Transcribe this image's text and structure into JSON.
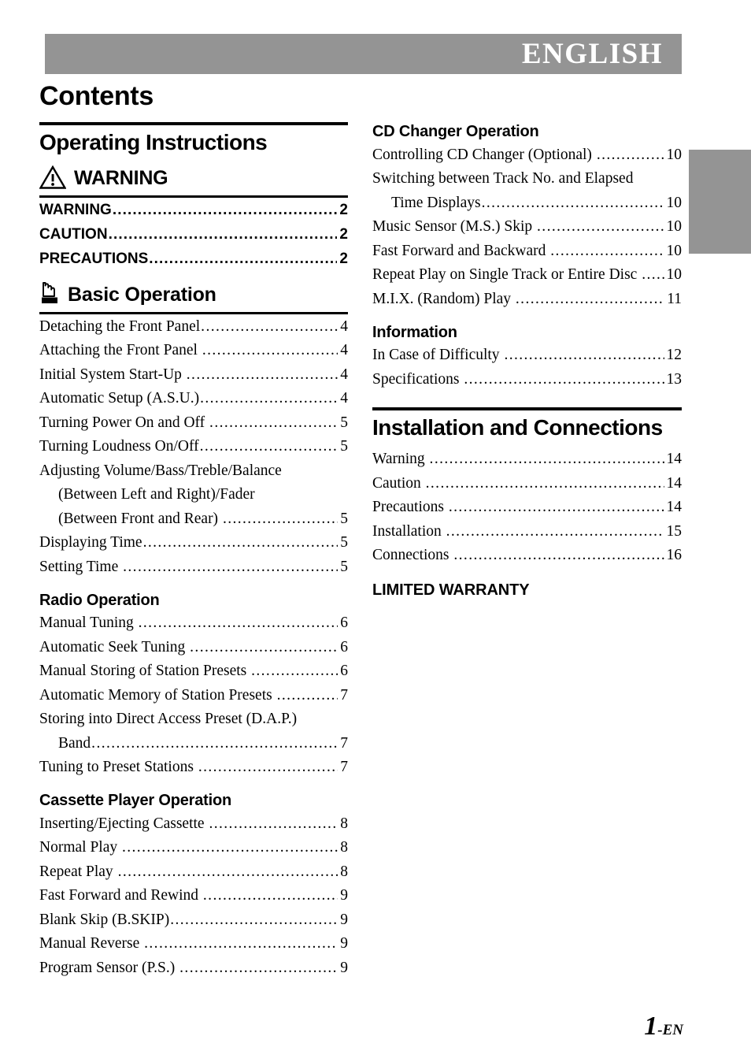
{
  "header": {
    "language_label": "ENGLISH",
    "band_color": "#949494"
  },
  "page_title": "Contents",
  "folio": {
    "number": "1",
    "suffix": "-EN"
  },
  "left_column": {
    "banner_heading": "Operating Instructions",
    "warning_section": {
      "icon": "warning-triangle-icon",
      "heading": "WARNING",
      "entries": [
        {
          "title": "WARNING",
          "page": "2"
        },
        {
          "title": "CAUTION",
          "page": "2"
        },
        {
          "title": "PRECAUTIONS",
          "page": "2"
        }
      ]
    },
    "basic_operation": {
      "icon": "hand-press-button-icon",
      "heading": "Basic Operation",
      "entries": [
        {
          "title": "Detaching the Front Panel",
          "page": "4"
        },
        {
          "title": "Attaching the Front Panel ",
          "page": "4"
        },
        {
          "title": "Initial System Start-Up ",
          "page": "4"
        },
        {
          "title": "Automatic Setup (A.S.U.)",
          "page": "4"
        },
        {
          "title": "Turning Power On and Off ",
          "page": "5"
        },
        {
          "title": "Turning Loudness On/Off",
          "page": "5"
        },
        {
          "title": "Adjusting Volume/Bass/Treble/Balance",
          "page": "",
          "leader": false
        },
        {
          "title": "(Between Left and Right)/Fader",
          "page": "",
          "leader": false,
          "indent": true
        },
        {
          "title": "(Between Front and Rear) ",
          "page": "5",
          "indent": true
        },
        {
          "title": "Displaying Time",
          "page": "5"
        },
        {
          "title": "Setting Time ",
          "page": "5"
        }
      ]
    },
    "radio_operation": {
      "heading": "Radio Operation",
      "entries": [
        {
          "title": "Manual Tuning ",
          "page": "6"
        },
        {
          "title": "Automatic Seek Tuning ",
          "page": "6"
        },
        {
          "title": "Manual Storing of Station Presets ",
          "page": "6"
        },
        {
          "title": "Automatic Memory of Station Presets ",
          "page": "7"
        },
        {
          "title": "Storing into Direct Access Preset (D.A.P.)",
          "page": "",
          "leader": false
        },
        {
          "title": "Band",
          "page": "7",
          "indent": true
        },
        {
          "title": "Tuning to Preset Stations ",
          "page": "7"
        }
      ]
    },
    "cassette_player_operation": {
      "heading": "Cassette Player Operation",
      "entries": [
        {
          "title": "Inserting/Ejecting Cassette ",
          "page": "8"
        },
        {
          "title": "Normal Play ",
          "page": "8"
        },
        {
          "title": "Repeat Play ",
          "page": "8"
        },
        {
          "title": "Fast Forward and Rewind ",
          "page": "9"
        },
        {
          "title": "Blank Skip (B.SKIP)",
          "page": "9"
        },
        {
          "title": "Manual Reverse ",
          "page": "9"
        },
        {
          "title": "Program Sensor (P.S.) ",
          "page": "9"
        }
      ]
    }
  },
  "right_column": {
    "cd_changer_operation": {
      "heading": "CD Changer Operation",
      "entries": [
        {
          "title": "Controlling CD Changer (Optional) ",
          "page": "10"
        },
        {
          "title": "Switching between Track No. and Elapsed",
          "page": "",
          "leader": false
        },
        {
          "title": "Time Displays",
          "page": "10",
          "indent": true
        },
        {
          "title": "Music Sensor (M.S.) Skip ",
          "page": "10"
        },
        {
          "title": "Fast Forward and Backward ",
          "page": "10"
        },
        {
          "title": "Repeat Play on Single Track or Entire Disc ",
          "page": "10"
        },
        {
          "title": "M.I.X. (Random) Play ",
          "page": "11"
        }
      ]
    },
    "information": {
      "heading": "Information",
      "entries": [
        {
          "title": "In Case of Difficulty ",
          "page": "12"
        },
        {
          "title": "Specifications ",
          "page": "13"
        }
      ]
    },
    "installation_and_connections": {
      "banner_heading": "Installation and Connections",
      "entries": [
        {
          "title": "Warning ",
          "page": "14"
        },
        {
          "title": "Caution ",
          "page": "14"
        },
        {
          "title": "Precautions ",
          "page": "14"
        },
        {
          "title": "Installation ",
          "page": "15"
        },
        {
          "title": "Connections ",
          "page": "16"
        }
      ],
      "limited_warranty_label": "LIMITED WARRANTY"
    }
  }
}
